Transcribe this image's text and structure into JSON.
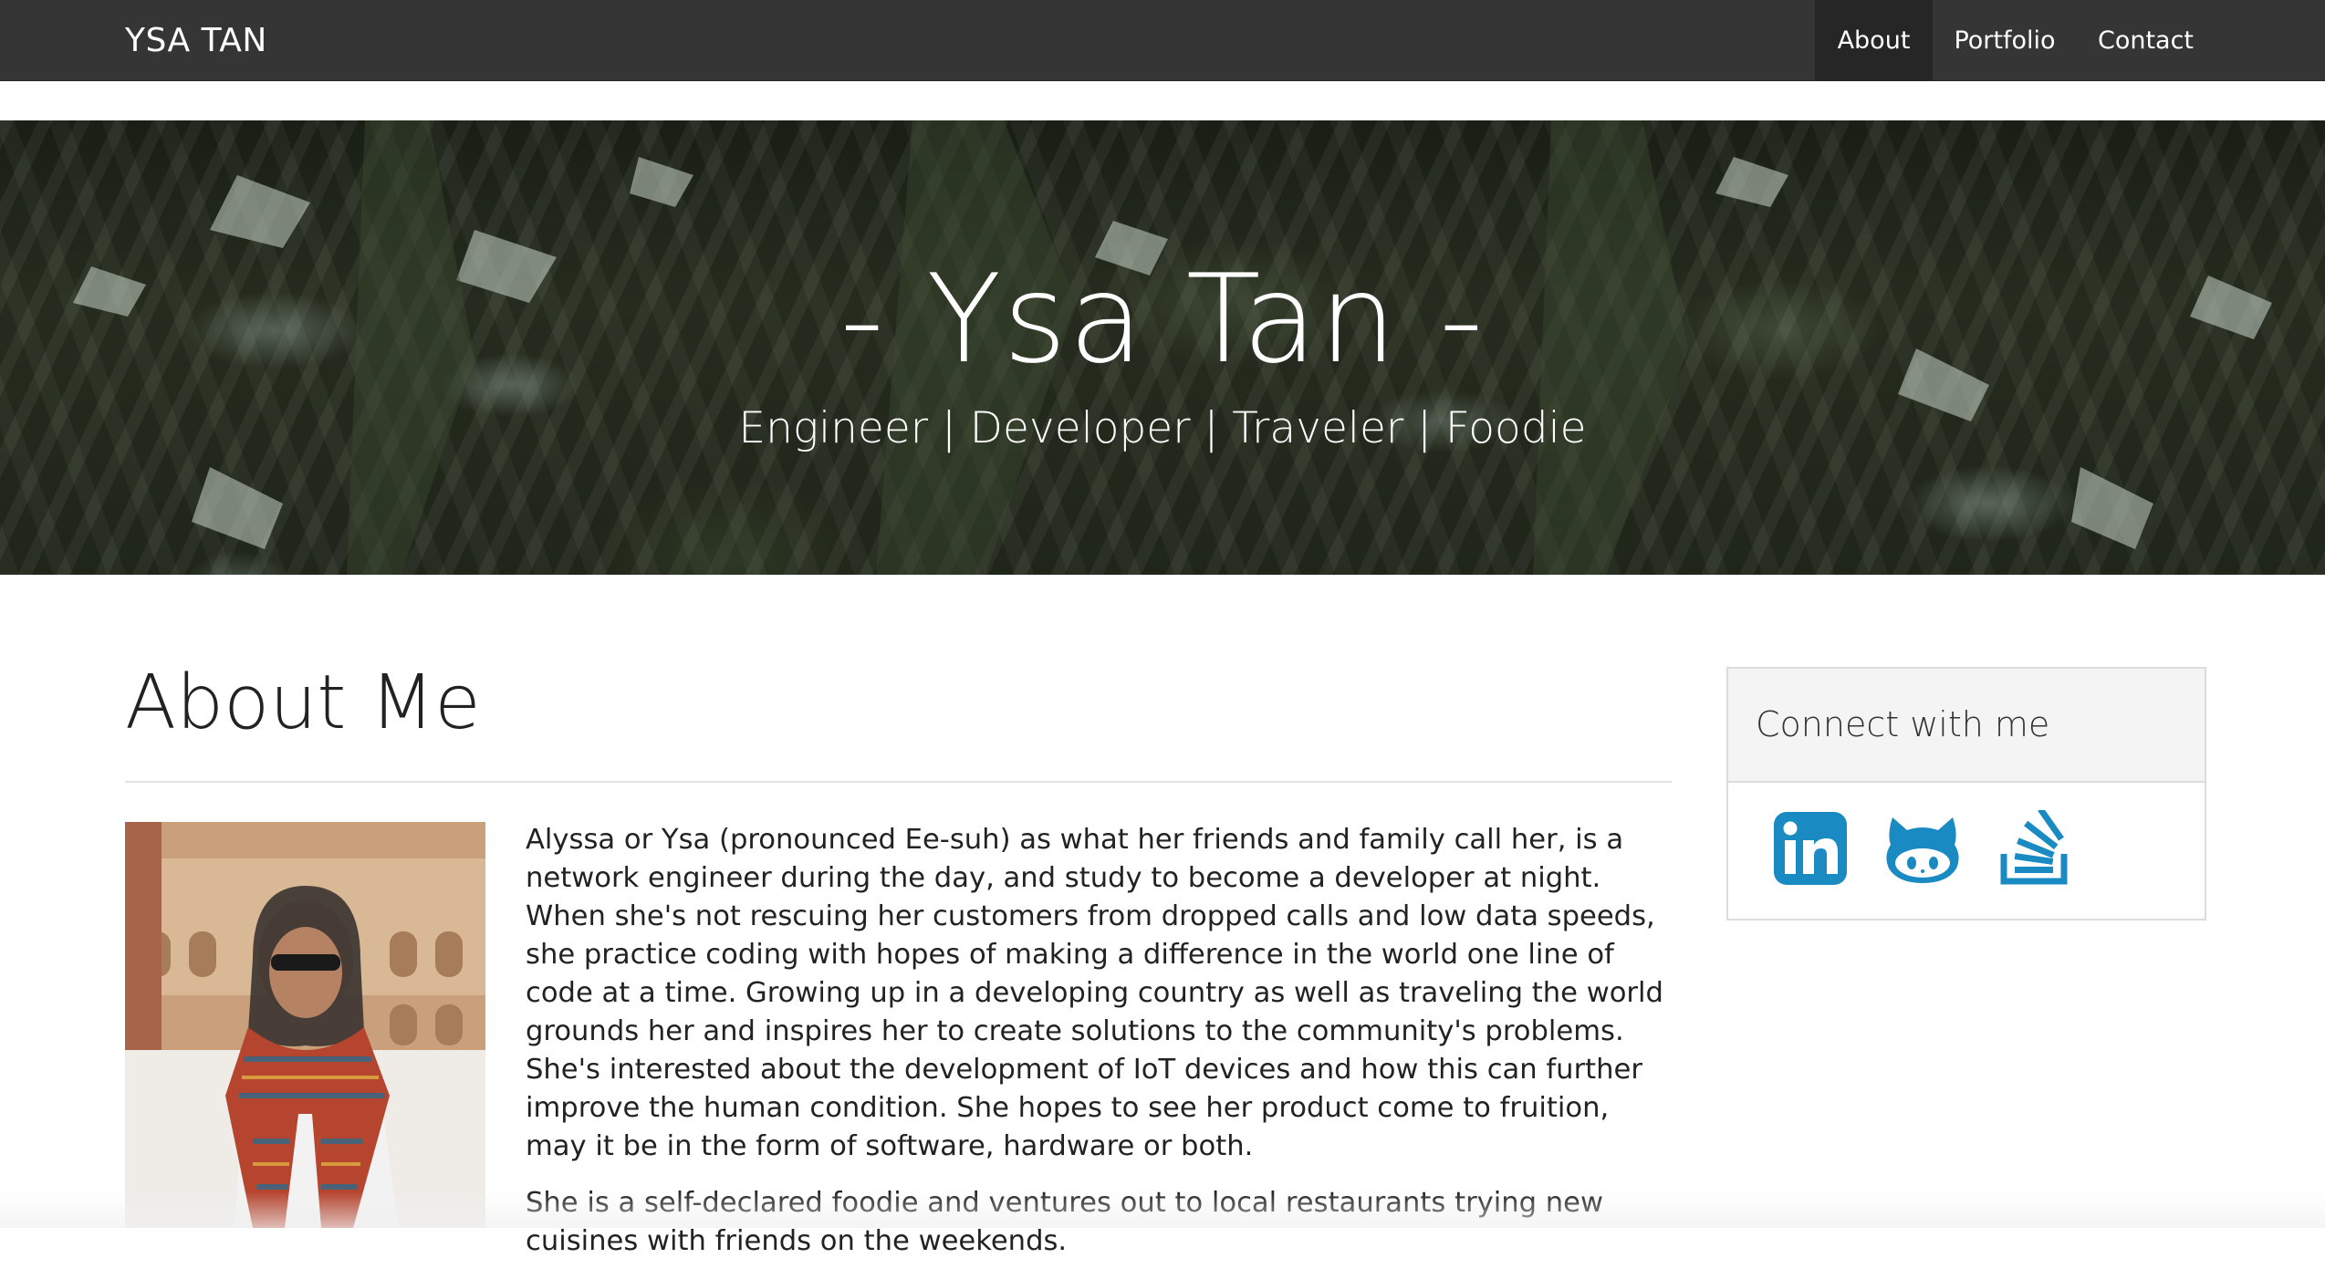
{
  "navbar": {
    "brand": "YSA TAN",
    "links": [
      {
        "label": "About",
        "active": true
      },
      {
        "label": "Portfolio",
        "active": false
      },
      {
        "label": "Contact",
        "active": false
      }
    ]
  },
  "hero": {
    "title": "- Ysa Tan -",
    "subtitle": "Engineer | Developer | Traveler | Foodie"
  },
  "about": {
    "heading": "About Me",
    "paragraphs": [
      "Alyssa or Ysa (pronounced Ee-suh) as what her friends and family call her, is a network engineer during the day, and study to become a developer at night. When she's not rescuing her customers from dropped calls and low data speeds, she practice coding with hopes of making a difference in the world one line of code at a time. Growing up in a developing country as well as traveling the world grounds her and inspires her to create solutions to the community's problems. She's interested about the development of IoT devices and how this can further improve the human condition. She hopes to see her product come to fruition, may it be in the form of software, hardware or both.",
      "She is a self-declared foodie and ventures out to local restaurants trying new cuisines with friends on the weekends."
    ]
  },
  "connect": {
    "title": "Connect with me",
    "icons": [
      "linkedin-icon",
      "github-icon",
      "stackoverflow-icon"
    ]
  },
  "colors": {
    "navbar_bg": "#353535",
    "navbar_active_bg": "#262626",
    "icon_blue": "#1a8ac3"
  }
}
